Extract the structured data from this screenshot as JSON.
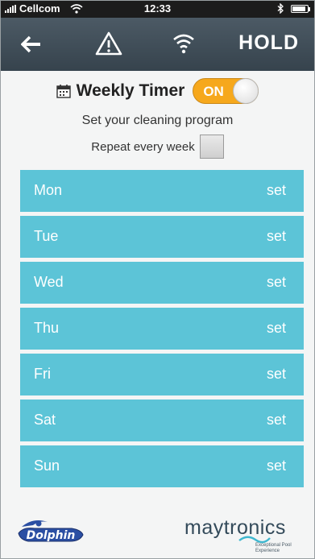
{
  "status_bar": {
    "carrier": "Cellcom",
    "time": "12:33"
  },
  "nav": {
    "hold_label": "HOLD",
    "icons": [
      "back-arrow-icon",
      "warning-icon",
      "wifi-icon"
    ]
  },
  "timer": {
    "title": "Weekly Timer",
    "toggle_label": "ON",
    "toggle_color": "#f6a81c",
    "subtitle": "Set your cleaning program",
    "repeat_label": "Repeat every week"
  },
  "days": [
    {
      "name": "Mon",
      "action": "set"
    },
    {
      "name": "Tue",
      "action": "set"
    },
    {
      "name": "Wed",
      "action": "set"
    },
    {
      "name": "Thu",
      "action": "set"
    },
    {
      "name": "Fri",
      "action": "set"
    },
    {
      "name": "Sat",
      "action": "set"
    },
    {
      "name": "Sun",
      "action": "set"
    }
  ],
  "day_row_color": "#5cc4d7",
  "footer": {
    "dolphin_logo_text": "Dolphin",
    "maytronics_logo_text": "maytronics",
    "maytronics_tagline": "Exceptional Pool Experience"
  }
}
